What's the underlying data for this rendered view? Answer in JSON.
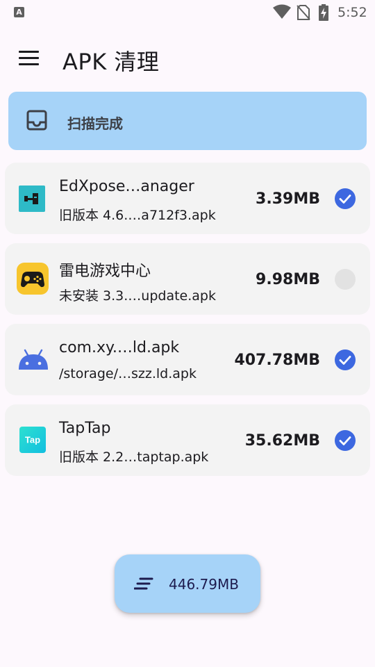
{
  "status_bar": {
    "notification_icon": "A",
    "icons": [
      "wifi-icon",
      "no-sim-icon",
      "battery-charging-icon"
    ],
    "time": "5:52"
  },
  "app_bar": {
    "menu_icon": "menu-icon",
    "title": "APK 清理"
  },
  "scan_banner": {
    "icon": "inbox-icon",
    "label": "扫描完成"
  },
  "apks": [
    {
      "icon": "edxposed-manager-icon",
      "icon_color": "#2ebac7",
      "name": "EdXpose…anager",
      "file": "旧版本 4.6.…a712f3.apk",
      "size": "3.39MB",
      "checked": true
    },
    {
      "icon": "leidian-game-center-icon",
      "icon_color": "#f7c52d",
      "name": "雷电游戏中心",
      "file": "未安装 3.3.…update.apk",
      "size": "9.98MB",
      "checked": false
    },
    {
      "icon": "android-robot-icon",
      "icon_color": "#4a6fe0",
      "name": "com.xy.…ld.apk",
      "file": "/storage/…szz.ld.apk",
      "size": "407.78MB",
      "checked": true
    },
    {
      "icon": "taptap-icon",
      "icon_color": "#1fd1d6",
      "name": "TapTap",
      "file": "旧版本 2.2…taptap.apk",
      "size": "35.62MB",
      "checked": true
    }
  ],
  "taptap_logo_text": "Tap",
  "fab": {
    "icon": "clean-sweep-icon",
    "label": "446.79MB"
  },
  "colors": {
    "background": "#fdf8fd",
    "accent_container": "#a6d3f8",
    "check_on": "#3d68e0",
    "check_off": "#e2e2e2",
    "card": "#f3f3f3"
  }
}
